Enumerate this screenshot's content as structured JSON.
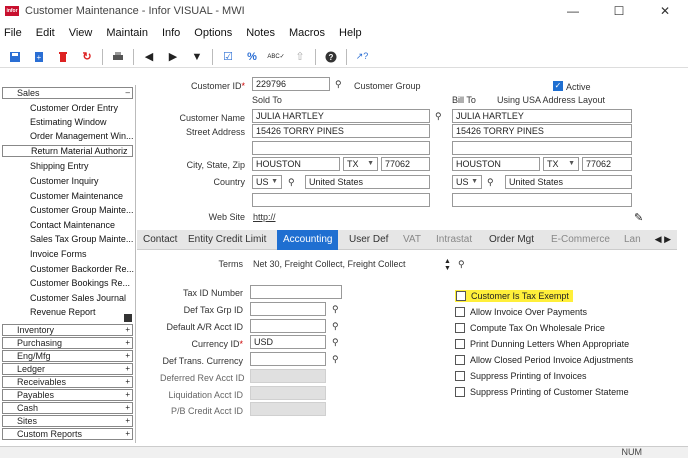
{
  "window": {
    "logo_text": "infor",
    "title": "Customer Maintenance - Infor VISUAL - MWI"
  },
  "menu": [
    "File",
    "Edit",
    "View",
    "Maintain",
    "Info",
    "Options",
    "Notes",
    "Macros",
    "Help"
  ],
  "toolbar": {
    "icons": [
      "save-icon",
      "add-icon",
      "delete-icon",
      "refresh-icon",
      "print-icon",
      "prev-icon",
      "next-icon",
      "dropdown-icon",
      "check-icon",
      "percent-icon",
      "spellcheck-icon",
      "upload-icon",
      "help-icon",
      "whats-this-icon"
    ]
  },
  "nav": {
    "sales_label": "Sales",
    "sales_items": [
      "Customer Order Entry",
      "Estimating Window",
      "Order Management Win...",
      "Return Material Authoriz",
      "Shipping Entry",
      "Customer Inquiry",
      "Customer Maintenance",
      "Customer Group Mainte...",
      "Contact Maintenance",
      "Sales Tax Group Mainte...",
      "Invoice Forms",
      "Customer Backorder Re...",
      "Customer Bookings Re...",
      "Customer Sales Journal",
      "Revenue Report"
    ],
    "groups": [
      "Inventory",
      "Purchasing",
      "Eng/Mfg",
      "Ledger",
      "Receivables",
      "Payables",
      "Cash",
      "Sites",
      "Custom Reports"
    ]
  },
  "form": {
    "customer_id_label": "Customer ID",
    "customer_id": "229796",
    "customer_group_label": "Customer Group",
    "active_label": "Active",
    "sold_to_label": "Sold To",
    "bill_to_label": "Bill To",
    "using_usa_label": "Using USA Address Layout",
    "customer_name_label": "Customer Name",
    "sold_name": "JULIA HARTLEY",
    "bill_name": "JULIA HARTLEY",
    "street_label": "Street Address",
    "sold_street": "15426 TORRY PINES",
    "bill_street": "15426 TORRY PINES",
    "city_label": "City, State, Zip",
    "sold_city": "HOUSTON",
    "sold_state": "TX",
    "sold_zip": "77062",
    "bill_city": "HOUSTON",
    "bill_state": "TX",
    "bill_zip": "77062",
    "country_label": "Country",
    "sold_country_code": "US",
    "sold_country": "United States",
    "bill_country_code": "US",
    "bill_country": "United States",
    "website_label": "Web Site",
    "website": "http://"
  },
  "tabs": [
    "Contact",
    "Entity Credit Limit",
    "Accounting",
    "User Def",
    "VAT",
    "Intrastat",
    "Order Mgt",
    "E-Commerce",
    "Lan"
  ],
  "accounting": {
    "terms_label": "Terms",
    "terms": "Net 30, Freight Collect, Freight Collect",
    "tax_id_label": "Tax ID Number",
    "def_tax_grp_label": "Def Tax Grp ID",
    "default_ar_label": "Default A/R Acct ID",
    "currency_label": "Currency ID",
    "currency": "USD",
    "def_trans_currency_label": "Def Trans. Currency",
    "deferred_rev_label": "Deferred Rev Acct ID",
    "liquidation_label": "Liquidation Acct ID",
    "pb_credit_label": "P/B Credit Acct ID",
    "checkboxes": [
      "Customer Is Tax Exempt",
      "Allow Invoice Over Payments",
      "Compute Tax On Wholesale Price",
      "Print Dunning Letters When Appropriate",
      "Allow Closed Period Invoice Adjustments",
      "Suppress Printing of Invoices",
      "Suppress Printing of Customer Stateme"
    ]
  },
  "status": {
    "num": "NUM"
  },
  "colors": {
    "accent": "#1f6fd1",
    "highlight": "#ffef3a",
    "logo": "#c8102e"
  }
}
